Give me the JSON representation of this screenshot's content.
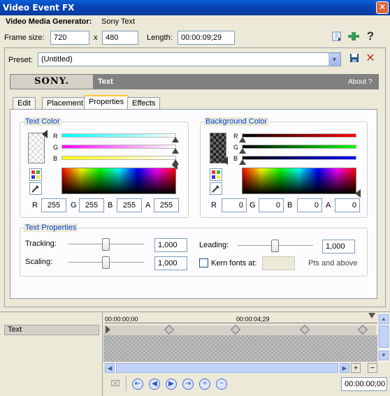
{
  "window": {
    "title": "Video Event FX",
    "close_glyph": "✕"
  },
  "generator": {
    "label": "Video Media Generator:",
    "name": "Sony Text"
  },
  "frame": {
    "label": "Frame size:",
    "width": "720",
    "times": "x",
    "height": "480",
    "length_label": "Length:",
    "length": "00:00:09;29"
  },
  "preset": {
    "label": "Preset:",
    "value": "(Untitled)"
  },
  "header": {
    "brand": "SONY.",
    "plugin_name": "Text",
    "about": "About ?"
  },
  "tabs": [
    {
      "label": "Edit"
    },
    {
      "label": "Placement"
    },
    {
      "label": "Properties"
    },
    {
      "label": "Effects"
    }
  ],
  "text_color": {
    "title": "Text Color",
    "channels": {
      "r": "R",
      "g": "G",
      "b": "B",
      "a": "A"
    },
    "values": {
      "r": "255",
      "g": "255",
      "b": "255",
      "a": "255"
    }
  },
  "background_color": {
    "title": "Background Color",
    "channels": {
      "r": "R",
      "g": "G",
      "b": "B",
      "a": "A"
    },
    "values": {
      "r": "0",
      "g": "0",
      "b": "0",
      "a": "0"
    }
  },
  "text_properties": {
    "title": "Text Properties",
    "tracking_label": "Tracking:",
    "tracking": "1,000",
    "scaling_label": "Scaling:",
    "scaling": "1,000",
    "leading_label": "Leading:",
    "leading": "1,000",
    "kern_label": "Kern fonts at:",
    "kern_value": "",
    "kern_suffix": "Pts and above"
  },
  "timeline": {
    "track_name": "Text",
    "time_start": "00:00:00;00",
    "time_mid": "00:00:04;29",
    "current_time": "00:00:00;00"
  },
  "colors": {
    "accent": "#0046d5",
    "title_bar": "#0a4fc8",
    "tab_highlight": "#ffc83c"
  }
}
